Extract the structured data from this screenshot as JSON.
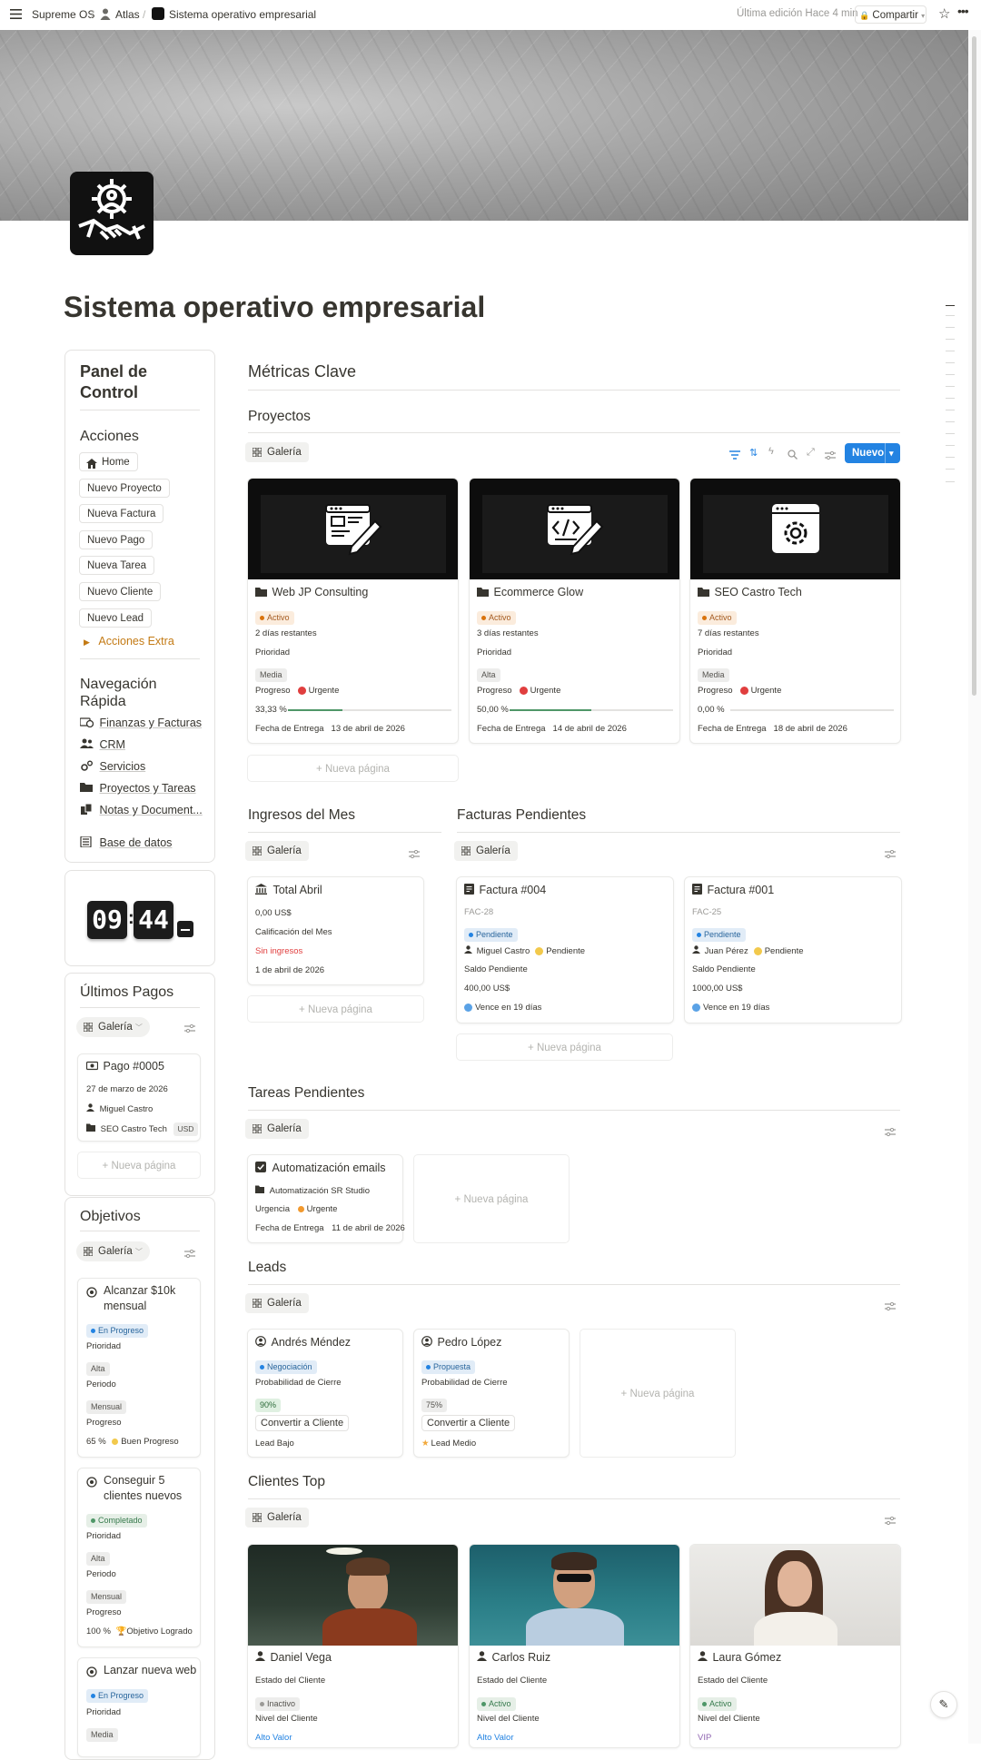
{
  "topbar": {
    "crumbs": [
      "Supreme OS",
      "Atlas",
      "Sistema operativo empresarial"
    ],
    "last_edit": "Última edición Hace 4 min",
    "share": "Compartir"
  },
  "page": {
    "title": "Sistema operativo empresarial"
  },
  "panel": {
    "title_line1": "Panel de",
    "title_line2": "Control",
    "actions_title": "Acciones",
    "actions": [
      "Home",
      "Nuevo Proyecto",
      "Nueva Factura",
      "Nuevo Pago",
      "Nueva Tarea",
      "Nuevo Cliente",
      "Nuevo Lead"
    ],
    "extra": "Acciones Extra",
    "nav_title_line1": "Navegación",
    "nav_title_line2": "Rápida",
    "nav": [
      "Finanzas y Facturas",
      "CRM",
      "Servicios",
      "Proyectos y Tareas",
      "Notas y Document...",
      "Base de datos"
    ]
  },
  "clock": {
    "hours": "09",
    "minutes": "44"
  },
  "ultimos_pagos": {
    "title": "Últimos Pagos",
    "view": "Galería",
    "card": {
      "title": "Pago #0005",
      "date": "27 de marzo de 2026",
      "person": "Miguel Castro",
      "project": "SEO Castro Tech",
      "currency": "USD"
    },
    "new_page": "Nueva página"
  },
  "objetivos": {
    "title": "Objetivos",
    "view": "Galería",
    "cards": [
      {
        "title_l1": "Alcanzar $10k",
        "title_l2": "mensual",
        "status": "En Progreso",
        "prioridad_label": "Prioridad",
        "prioridad": "Alta",
        "periodo_label": "Periodo",
        "periodo": "Mensual",
        "progreso_label": "Progreso",
        "progreso": "65 %",
        "estado": "Buen Progreso"
      },
      {
        "title_l1": "Conseguir 5",
        "title_l2": "clientes nuevos",
        "status": "Completado",
        "prioridad_label": "Prioridad",
        "prioridad": "Alta",
        "periodo_label": "Periodo",
        "periodo": "Mensual",
        "progreso_label": "Progreso",
        "progreso": "100 %",
        "estado": "Objetivo Logrado"
      },
      {
        "title_l1": "Lanzar nueva web",
        "status": "En Progreso",
        "prioridad_label": "Prioridad",
        "prioridad": "Media"
      }
    ]
  },
  "metricas": {
    "title": "Métricas Clave"
  },
  "proyectos": {
    "title": "Proyectos",
    "view": "Galería",
    "new_button": "Nuevo",
    "new_page": "Nueva página",
    "cards": [
      {
        "title": "Web JP Consulting",
        "status": "Activo",
        "remaining": "2 días restantes",
        "prioridad_label": "Prioridad",
        "prioridad": "Media",
        "progreso_label": "Progreso",
        "urgency": "Urgente",
        "percent": "33,33 %",
        "fill": 0.3333,
        "fecha_label": "Fecha de Entrega",
        "fecha": "13 de abril de 2026"
      },
      {
        "title": "Ecommerce Glow",
        "status": "Activo",
        "remaining": "3 días restantes",
        "prioridad_label": "Prioridad",
        "prioridad": "Alta",
        "progreso_label": "Progreso",
        "urgency": "Urgente",
        "percent": "50,00 %",
        "fill": 0.5,
        "fecha_label": "Fecha de Entrega",
        "fecha": "14 de abril de 2026"
      },
      {
        "title": "SEO Castro Tech",
        "status": "Activo",
        "remaining": "7 días restantes",
        "prioridad_label": "Prioridad",
        "prioridad": "Media",
        "progreso_label": "Progreso",
        "urgency": "Urgente",
        "percent": "0,00 %",
        "fill": 0,
        "fecha_label": "Fecha de Entrega",
        "fecha": "18 de abril de 2026"
      }
    ]
  },
  "ingresos": {
    "title": "Ingresos del Mes",
    "view": "Galería",
    "card": {
      "title": "Total Abril",
      "amount": "0,00 US$",
      "calif_label": "Calificación del Mes",
      "calif": "Sin ingresos",
      "date": "1 de abril de 2026"
    },
    "new_page": "Nueva página"
  },
  "facturas": {
    "title": "Facturas Pendientes",
    "view": "Galería",
    "cards": [
      {
        "title": "Factura #004",
        "code": "FAC-28",
        "status": "Pendiente",
        "person": "Miguel Castro",
        "pstatus": "Pendiente",
        "saldo_label": "Saldo Pendiente",
        "saldo": "400,00 US$",
        "vence": "Vence en 19 días"
      },
      {
        "title": "Factura #001",
        "code": "FAC-25",
        "status": "Pendiente",
        "person": "Juan Pérez",
        "pstatus": "Pendiente",
        "saldo_label": "Saldo Pendiente",
        "saldo": "1000,00 US$",
        "vence": "Vence en 19 días"
      }
    ],
    "new_page": "Nueva página"
  },
  "tareas": {
    "title": "Tareas Pendientes",
    "view": "Galería",
    "card": {
      "title": "Automatización emails",
      "project": "Automatización SR Studio",
      "urgencia_label": "Urgencia",
      "urgencia": "Urgente",
      "fecha_label": "Fecha de Entrega",
      "fecha": "11 de abril de 2026"
    },
    "new_page": "Nueva página"
  },
  "leads": {
    "title": "Leads",
    "view": "Galería",
    "cards": [
      {
        "title": "Andrés Méndez",
        "status": "Negociación",
        "prob_label": "Probabilidad de Cierre",
        "prob": "90%",
        "button": "Convertir a Cliente",
        "lead": "Lead Bajo"
      },
      {
        "title": "Pedro López",
        "status": "Propuesta",
        "prob_label": "Probabilidad de Cierre",
        "prob": "75%",
        "button": "Convertir a Cliente",
        "lead": "Lead Medio"
      }
    ],
    "new_page": "Nueva página"
  },
  "clientes": {
    "title": "Clientes Top",
    "view": "Galería",
    "cards": [
      {
        "name": "Daniel Vega",
        "estado_label": "Estado del Cliente",
        "estado": "Inactivo",
        "nivel_label": "Nivel del Cliente",
        "nivel": "Alto Valor"
      },
      {
        "name": "Carlos Ruiz",
        "estado_label": "Estado del Cliente",
        "estado": "Activo",
        "nivel_label": "Nivel del Cliente",
        "nivel": "Alto Valor"
      },
      {
        "name": "Laura Gómez",
        "estado_label": "Estado del Cliente",
        "estado": "Activo",
        "nivel_label": "Nivel del Cliente",
        "nivel": "VIP"
      }
    ]
  },
  "colors": {
    "accent": "#2383e2",
    "orange": "#d9730d",
    "red": "#e03e3e",
    "green": "#4f9768"
  },
  "icons": [
    "menu-icon",
    "star-icon",
    "more-icon",
    "gallery-icon",
    "filter-icon",
    "sort-icon",
    "bolt-icon",
    "search-icon",
    "expand-icon",
    "settings-icon",
    "folder-icon",
    "bank-icon",
    "invoice-icon",
    "checkbox-icon",
    "person-icon",
    "target-icon",
    "cash-icon",
    "home-icon"
  ]
}
